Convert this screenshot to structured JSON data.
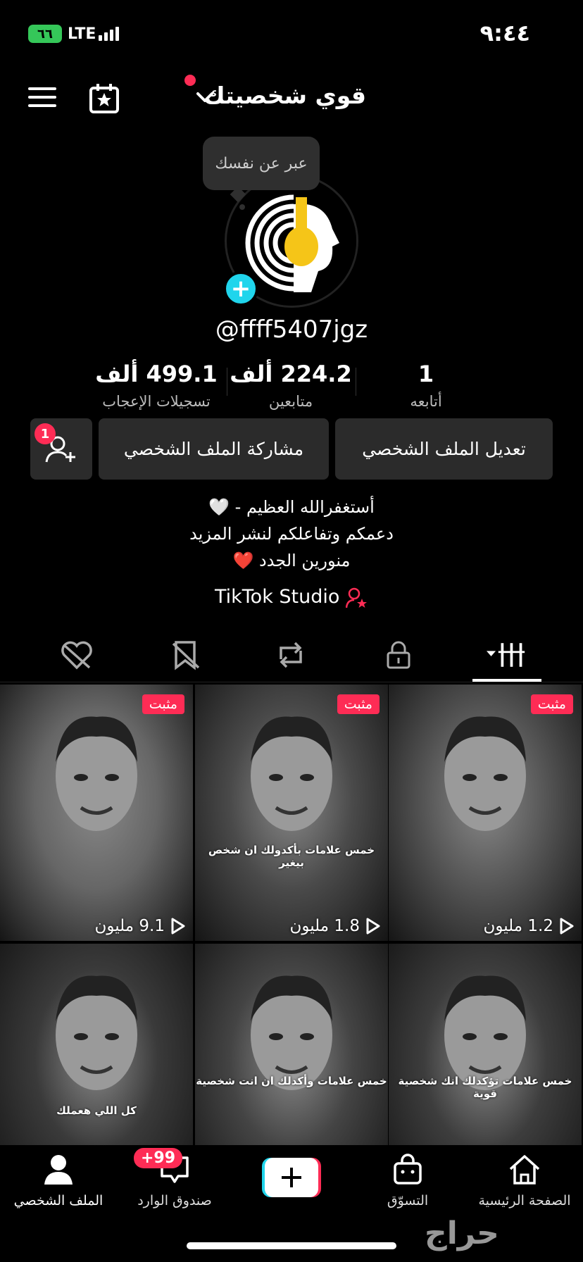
{
  "status": {
    "time": "٩:٤٤",
    "network": "LTE",
    "battery": "٦٦"
  },
  "header": {
    "title": "قوي شخصيتك"
  },
  "avatar": {
    "tooltip": "عبر عن نفسك"
  },
  "profile": {
    "handle": "@ffff5407jgz"
  },
  "stats": [
    {
      "value": "1",
      "label": "أتابعه"
    },
    {
      "value": "224.2 ألف",
      "label": "متابعين"
    },
    {
      "value": "499.1 ألف",
      "label": "تسجيلات الإعجاب"
    }
  ],
  "buttons": {
    "edit": "تعديل الملف الشخصي",
    "share": "مشاركة الملف الشخصي",
    "follow_badge": "1"
  },
  "bio": {
    "line1": "أستغفرالله العظيم - 🤍",
    "line2": "دعمكم وتفاعلكم لنشر المزيد",
    "line3": "منورين الجدد ❤️",
    "studio": "TikTok Studio"
  },
  "tabs": [
    "videos-icon",
    "lock-icon",
    "repost-icon",
    "tagged-icon",
    "liked-icon"
  ],
  "grid": [
    {
      "pinned": "مثبت",
      "views": "1.2 مليون",
      "caption": ""
    },
    {
      "pinned": "مثبت",
      "views": "1.8 مليون",
      "caption": "خمس علامات بأكدولك ان شخص بيغير"
    },
    {
      "pinned": "مثبت",
      "views": "9.1 مليون",
      "caption": ""
    },
    {
      "pinned": "",
      "views": "",
      "caption": "خمس علامات تؤكدلك انك شخصية قوية"
    },
    {
      "pinned": "",
      "views": "",
      "caption": "خمس علامات وأكدلك ان انت شخصية"
    },
    {
      "pinned": "",
      "views": "",
      "caption": "كل اللي هعملك"
    }
  ],
  "nav": {
    "home": "الصفحة الرئيسية",
    "shop": "التسوّق",
    "inbox": "صندوق الوارد",
    "inbox_badge": "+99",
    "profile": "الملف الشخصي"
  },
  "watermark": "حراج",
  "colors": {
    "accent": "#fe2c55",
    "cyan": "#20d5ec",
    "avatar_yellow": "#f5c518"
  }
}
